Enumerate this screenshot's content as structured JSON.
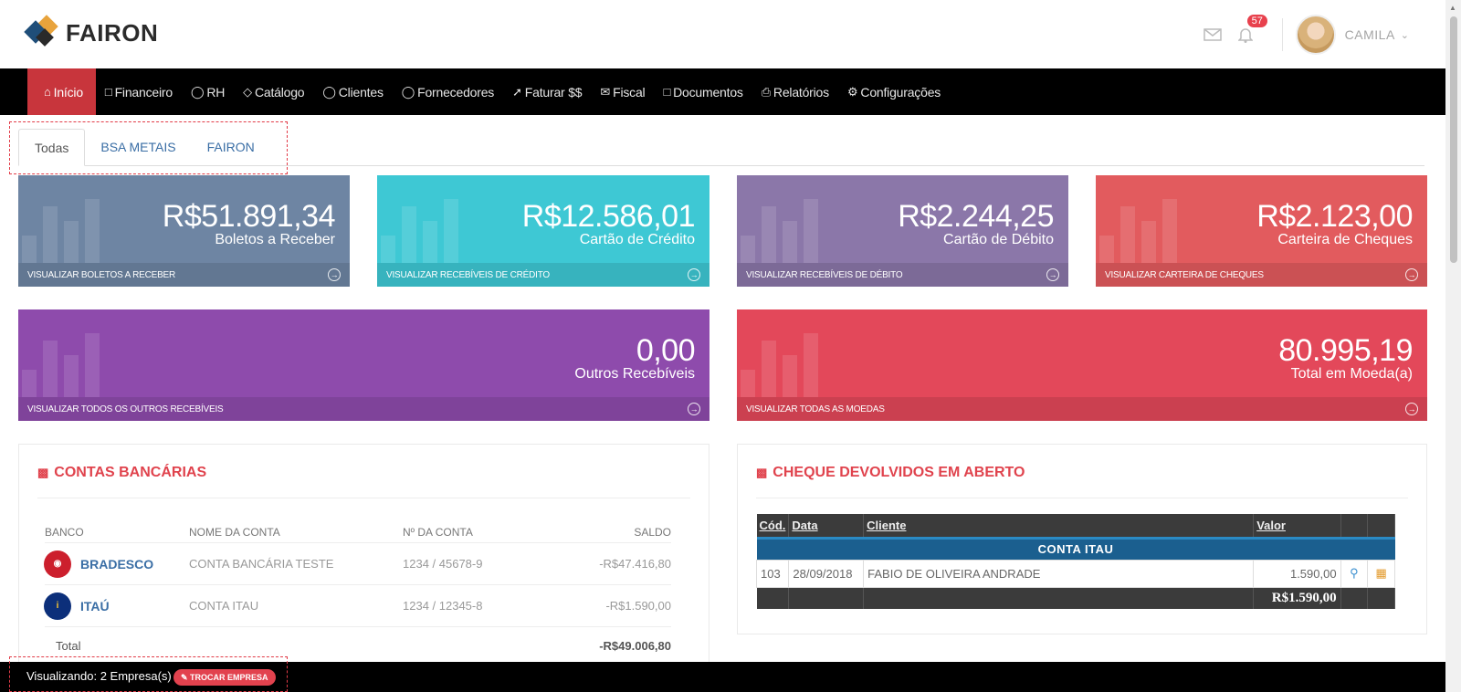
{
  "brand": {
    "name": "FAIRON"
  },
  "header": {
    "notifications_count": "57",
    "user_name": "CAMILA"
  },
  "nav": [
    {
      "label": "Início",
      "icon": "home-icon"
    },
    {
      "label": "Financeiro",
      "icon": "folder-icon"
    },
    {
      "label": "RH",
      "icon": "users-icon"
    },
    {
      "label": "Catálogo",
      "icon": "tag-icon"
    },
    {
      "label": "Clientes",
      "icon": "user-icon"
    },
    {
      "label": "Fornecedores",
      "icon": "user-icon"
    },
    {
      "label": "Faturar $$",
      "icon": "rocket-icon"
    },
    {
      "label": "Fiscal",
      "icon": "envelope-icon"
    },
    {
      "label": "Documentos",
      "icon": "folder-icon"
    },
    {
      "label": "Relatórios",
      "icon": "printer-icon"
    },
    {
      "label": "Configurações",
      "icon": "gear-icon"
    }
  ],
  "tabs": [
    "Todas",
    "BSA METAIS",
    "FAIRON"
  ],
  "cards": [
    {
      "value": "R$51.891,34",
      "label": "Boletos a Receber",
      "link": "VISUALIZAR BOLETOS A RECEBER",
      "color": "#6e85a3"
    },
    {
      "value": "R$12.586,01",
      "label": "Cartão de Crédito",
      "link": "VISUALIZAR RECEBÍVEIS DE CRÉDITO",
      "color": "#3ec8d4"
    },
    {
      "value": "R$2.244,25",
      "label": "Cartão de Débito",
      "link": "VISUALIZAR RECEBÍVEIS DE DÉBITO",
      "color": "#8b77a9"
    },
    {
      "value": "R$2.123,00",
      "label": "Carteira de Cheques",
      "link": "VISUALIZAR CARTEIRA DE CHEQUES",
      "color": "#e25b5e"
    },
    {
      "value": "0,00",
      "label": "Outros Recebíveis",
      "link": "VISUALIZAR TODOS OS OUTROS RECEBÍVEIS",
      "color": "#8e4bac"
    },
    {
      "value": "80.995,19",
      "label": "Total em Moeda(a)",
      "link": "VISUALIZAR TODAS AS MOEDAS",
      "color": "#e3485a"
    }
  ],
  "bank_panel": {
    "title": "CONTAS BANCÁRIAS",
    "headers": [
      "BANCO",
      "NOME DA CONTA",
      "Nº DA CONTA",
      "SALDO"
    ],
    "rows": [
      {
        "bank": "BRADESCO",
        "account_name": "CONTA BANCÁRIA TESTE",
        "account_no": "1234 / 45678-9",
        "balance": "-R$47.416,80"
      },
      {
        "bank": "ITAÚ",
        "account_name": "CONTA ITAU",
        "account_no": "1234 / 12345-8",
        "balance": "-R$1.590,00"
      }
    ],
    "total_label": "Total",
    "total_value": "-R$49.006,80"
  },
  "cheque_panel": {
    "title": "CHEQUE DEVOLVIDOS EM ABERTO",
    "headers": [
      "Cód.",
      "Data",
      "Cliente",
      "Valor"
    ],
    "group": "CONTA ITAU",
    "rows": [
      {
        "code": "103",
        "date": "28/09/2018",
        "client": "FABIO DE OLIVEIRA ANDRADE",
        "value": "1.590,00"
      }
    ],
    "total": "R$1.590,00"
  },
  "footer": {
    "viewing": "Visualizando: 2 Empresa(s)",
    "switch_label": "TROCAR EMPRESA"
  }
}
